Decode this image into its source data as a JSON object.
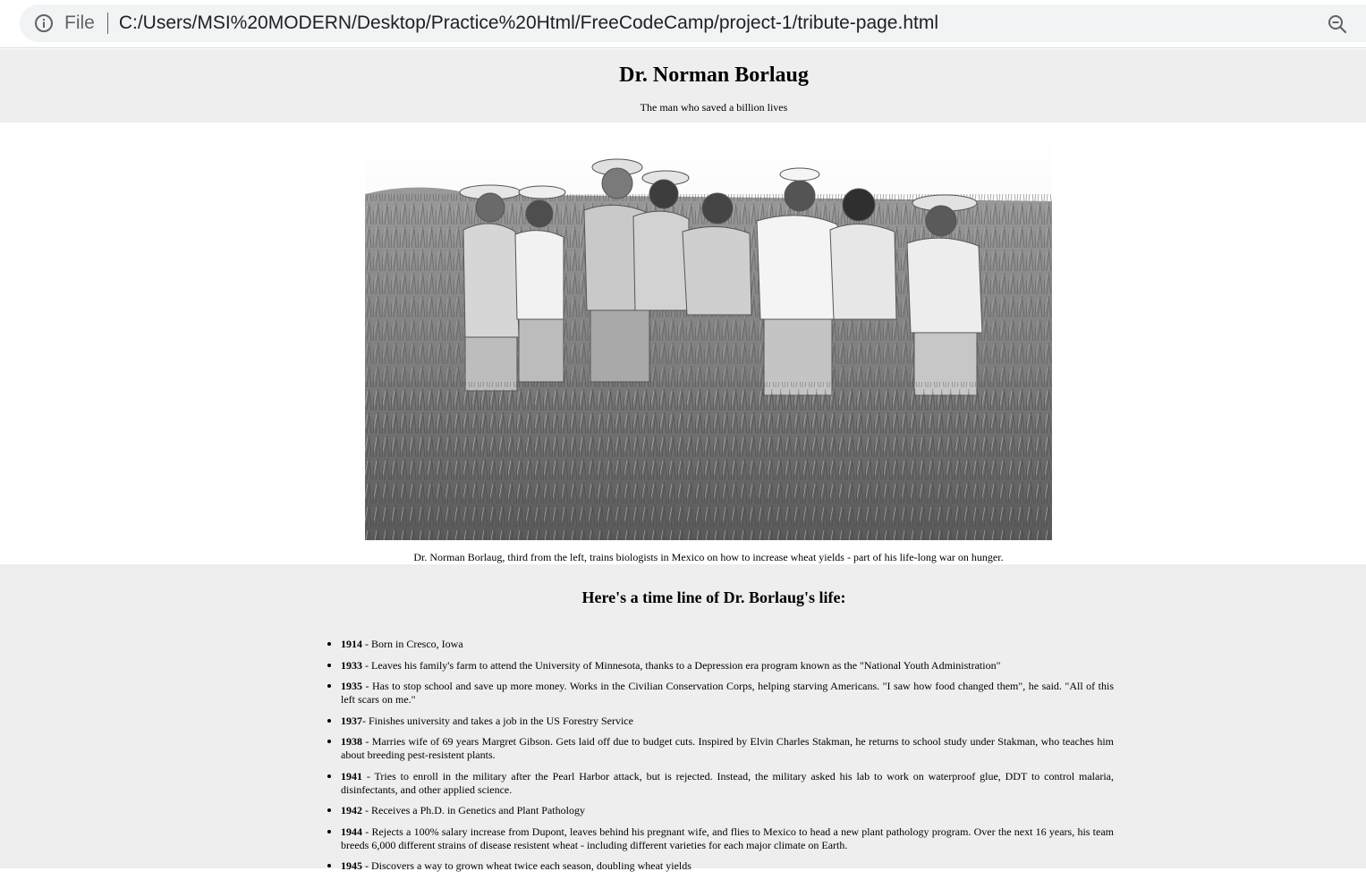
{
  "browser": {
    "file_label": "File",
    "url": "C:/Users/MSI%20MODERN/Desktop/Practice%20Html/FreeCodeCamp/project-1/tribute-page.html"
  },
  "header": {
    "title": "Dr. Norman Borlaug",
    "subtitle": "The man who saved a billion lives"
  },
  "figure": {
    "caption": "Dr. Norman Borlaug, third from the left, trains biologists in Mexico on how to increase wheat yields - part of his life-long war on hunger."
  },
  "timeline": {
    "heading": "Here's a time line of Dr. Borlaug's life:",
    "items": [
      {
        "year": "1914",
        "text": " - Born in Cresco, Iowa"
      },
      {
        "year": "1933",
        "text": " - Leaves his family's farm to attend the University of Minnesota, thanks to a Depression era program known as the \"National Youth Administration\""
      },
      {
        "year": "1935",
        "text": " - Has to stop school and save up more money. Works in the Civilian Conservation Corps, helping starving Americans. \"I saw how food changed them\", he said. \"All of this left scars on me.\""
      },
      {
        "year": "1937",
        "text": "- Finishes university and takes a job in the US Forestry Service"
      },
      {
        "year": "1938",
        "text": " - Marries wife of 69 years Margret Gibson. Gets laid off due to budget cuts. Inspired by Elvin Charles Stakman, he returns to school study under Stakman, who teaches him about breeding pest-resistent plants."
      },
      {
        "year": "1941",
        "text": " - Tries to enroll in the military after the Pearl Harbor attack, but is rejected. Instead, the military asked his lab to work on waterproof glue, DDT to control malaria, disinfectants, and other applied science."
      },
      {
        "year": "1942",
        "text": " - Receives a Ph.D. in Genetics and Plant Pathology"
      },
      {
        "year": "1944",
        "text": " - Rejects a 100% salary increase from Dupont, leaves behind his pregnant wife, and flies to Mexico to head a new plant pathology program. Over the next 16 years, his team breeds 6,000 different strains of disease resistent wheat - including different varieties for each major climate on Earth."
      },
      {
        "year": "1945",
        "text": " - Discovers a way to grown wheat twice each season, doubling wheat yields"
      }
    ]
  }
}
